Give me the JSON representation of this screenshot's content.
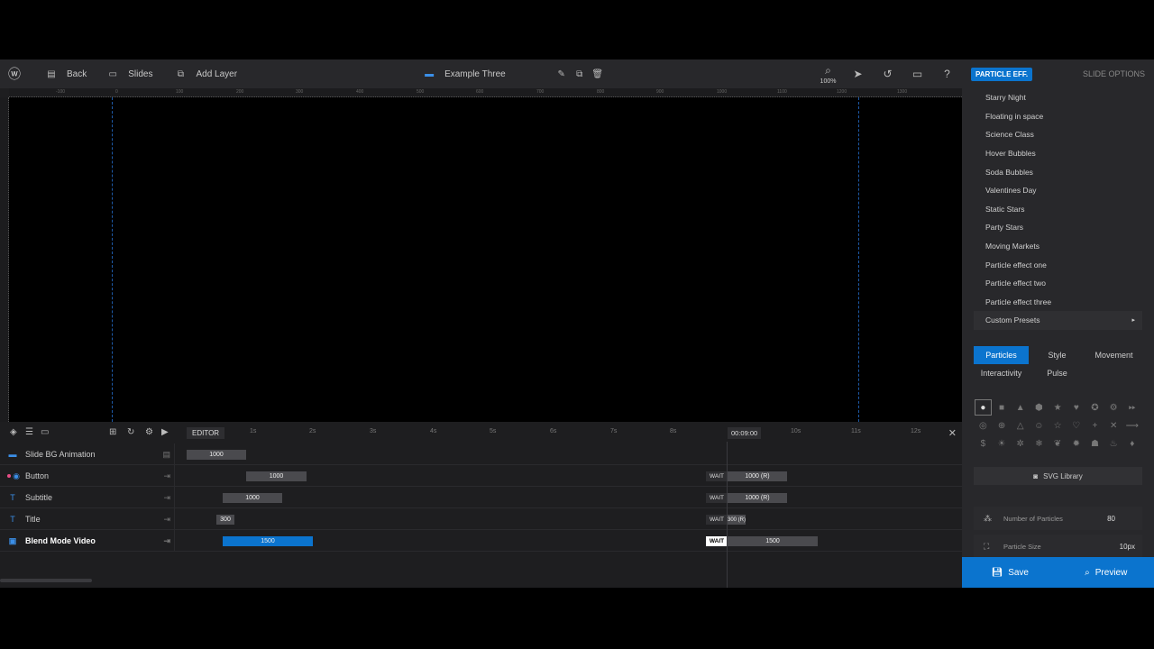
{
  "topbar": {
    "back": "Back",
    "slides": "Slides",
    "add_layer": "Add Layer",
    "slide_name": "Example Three",
    "zoom": "100%"
  },
  "ruler": [
    "-100",
    "0",
    "100",
    "200",
    "300",
    "400",
    "500",
    "600",
    "700",
    "800",
    "900",
    "1000",
    "1100",
    "1200",
    "1300"
  ],
  "right_panel": {
    "active_tab": "PARTICLE EFF.",
    "slide_options": "SLIDE OPTIONS",
    "presets": [
      "Starry Night",
      "Floating in space",
      "Science Class",
      "Hover Bubbles",
      "Soda Bubbles",
      "Valentines Day",
      "Static Stars",
      "Party Stars",
      "Moving Markets",
      "Particle effect one",
      "Particle effect two",
      "Particle effect three"
    ],
    "custom_presets": "Custom Presets",
    "tabs": [
      "Particles",
      "Style",
      "Movement",
      "Interactivity",
      "Pulse"
    ],
    "svg_library": "SVG Library",
    "number_of_particles_label": "Number of Particles",
    "number_of_particles_value": "80",
    "particle_size_label": "Particle Size",
    "particle_size_value": "10px",
    "save": "Save",
    "preview": "Preview"
  },
  "timeline": {
    "editor": "EDITOR",
    "current_time": "00:09:00",
    "ticks": [
      "1s",
      "2s",
      "3s",
      "4s",
      "5s",
      "6s",
      "7s",
      "8s",
      "9s",
      "10s",
      "11s",
      "12s"
    ],
    "rows": [
      {
        "name": "Slide BG Animation",
        "bar1": "1000",
        "wait": "",
        "bar2": ""
      },
      {
        "name": "Button",
        "bar1": "1000",
        "wait": "WAIT",
        "bar2": "1000 (R)"
      },
      {
        "name": "Subtitle",
        "bar1": "1000",
        "wait": "WAIT",
        "bar2": "1000 (R)"
      },
      {
        "name": "Title",
        "bar1": "300",
        "wait": "WAIT",
        "bar2": "300 (R)"
      },
      {
        "name": "Blend Mode Video",
        "bar1": "1500",
        "wait": "WAIT",
        "bar2": "1500"
      }
    ]
  },
  "colors": {
    "accent": "#0b74ce",
    "panel": "#28282b",
    "canvas": "#000000"
  }
}
